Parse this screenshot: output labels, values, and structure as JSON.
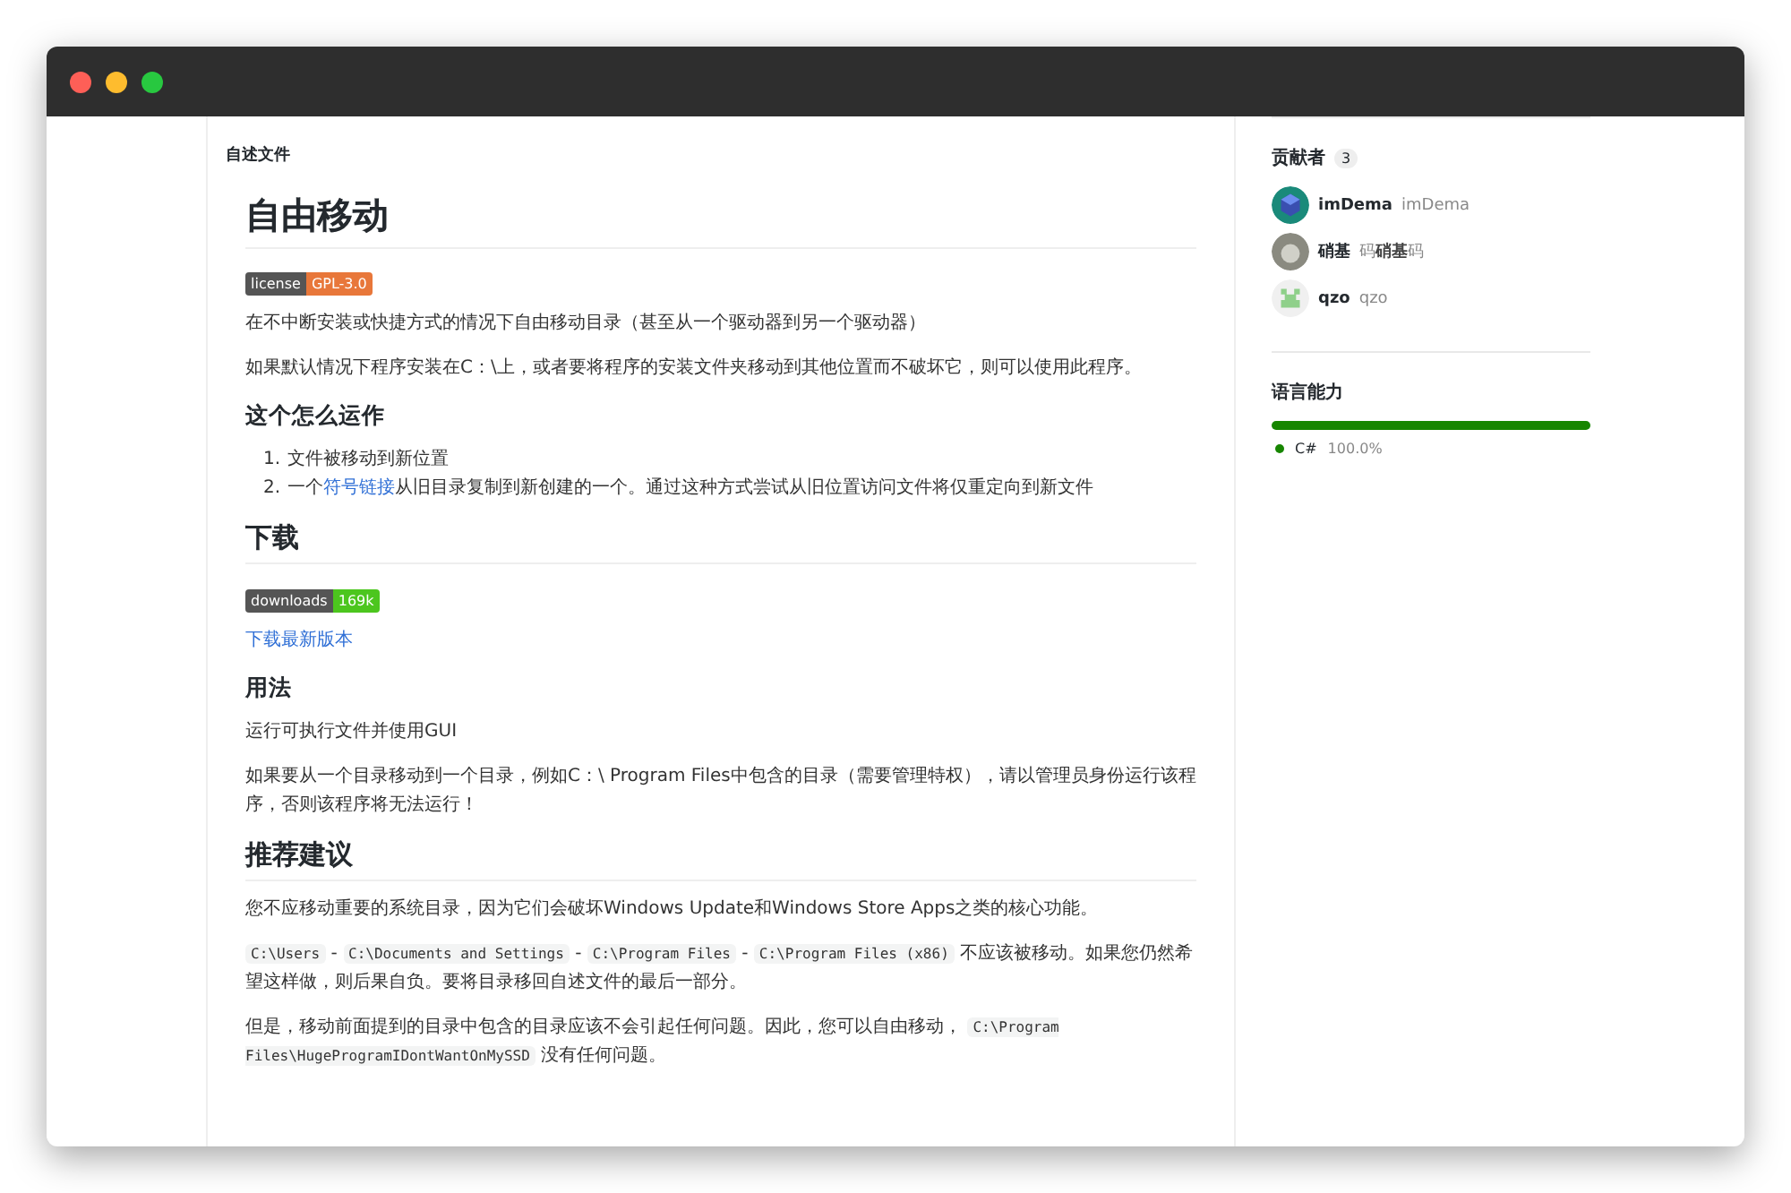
{
  "readme": {
    "label": "自述文件",
    "blocks": [
      {
        "kind": "h1",
        "text": "自由移动"
      },
      {
        "kind": "badge",
        "label": "license",
        "value": "GPL-3.0",
        "color": "#e8773a"
      },
      {
        "kind": "p",
        "segments": [
          {
            "kind": "text",
            "text": "在不中断安装或快捷方式的情况下自由移动目录（甚至从一个驱动器到另一个驱动器）"
          }
        ]
      },
      {
        "kind": "p",
        "segments": [
          {
            "kind": "text",
            "text": "如果默认情况下程序安装在C：\\上，或者要将程序的安装文件夹移动到其他位置而不破坏它，则可以使用此程序。"
          }
        ]
      },
      {
        "kind": "h3",
        "text": "这个怎么运作"
      },
      {
        "kind": "ol",
        "items": [
          {
            "number": "1.",
            "segments": [
              {
                "kind": "text",
                "text": "文件被移动到新位置"
              }
            ]
          },
          {
            "number": "2.",
            "segments": [
              {
                "kind": "text",
                "text": "一个"
              },
              {
                "kind": "link",
                "text": "符号链接"
              },
              {
                "kind": "text",
                "text": "从旧目录复制到新创建的一个。通过这种方式尝试从旧位置访问文件将仅重定向到新文件"
              }
            ]
          }
        ]
      },
      {
        "kind": "h2",
        "text": "下载"
      },
      {
        "kind": "badge",
        "label": "downloads",
        "value": "169k",
        "color": "#4cc61e"
      },
      {
        "kind": "p",
        "segments": [
          {
            "kind": "link",
            "text": "下载最新版本"
          }
        ]
      },
      {
        "kind": "h3",
        "text": "用法"
      },
      {
        "kind": "p",
        "segments": [
          {
            "kind": "text",
            "text": "运行可执行文件并使用GUI"
          }
        ]
      },
      {
        "kind": "p",
        "segments": [
          {
            "kind": "text",
            "text": "如果要从一个目录移动到一个目录，例如C：\\ Program Files中包含的目录（需要管理特权），请以管理员身份运行该程序，否则该程序将无法运行！"
          }
        ]
      },
      {
        "kind": "h2",
        "text": "推荐建议"
      },
      {
        "kind": "p",
        "segments": [
          {
            "kind": "text",
            "text": "您不应移动重要的系统目录，因为它们会破坏Windows Update和Windows Store Apps之类的核心功能。"
          }
        ]
      },
      {
        "kind": "p",
        "segments": [
          {
            "kind": "code",
            "text": "C:\\Users"
          },
          {
            "kind": "text",
            "text": " - "
          },
          {
            "kind": "code",
            "text": "C:\\Documents and Settings"
          },
          {
            "kind": "text",
            "text": " - "
          },
          {
            "kind": "code",
            "text": "C:\\Program Files"
          },
          {
            "kind": "text",
            "text": " - "
          },
          {
            "kind": "code",
            "text": "C:\\Program Files (x86)"
          },
          {
            "kind": "text",
            "text": " 不应该被移动。如果您仍然希望这样做，则后果自负。要将目录移回自述文件的最后一部分。"
          }
        ]
      },
      {
        "kind": "p",
        "segments": [
          {
            "kind": "text",
            "text": "但是，移动前面提到的目录中包含的目录应该不会引起任何问题。因此，您可以自由移动， "
          },
          {
            "kind": "code",
            "text": "C:\\Program Files\\HugeProgramIDontWantOnMySSD"
          },
          {
            "kind": "text",
            "text": " 没有任何问题。"
          }
        ]
      }
    ]
  },
  "sidebar": {
    "contributors": {
      "title": "贡献者",
      "count": "3",
      "people": [
        {
          "name": "imDema",
          "handle": "imDema",
          "kind": "cube"
        },
        {
          "name": "硝基",
          "handle": "码**硝基**码",
          "kind": "photo"
        },
        {
          "name": "qzo",
          "handle": "qzo",
          "kind": "pixel"
        }
      ]
    },
    "languages": {
      "title": "语言能力",
      "items": [
        {
          "name": "C#",
          "percent": "100.0%",
          "color": "#178600",
          "level": 1.0
        }
      ]
    }
  }
}
